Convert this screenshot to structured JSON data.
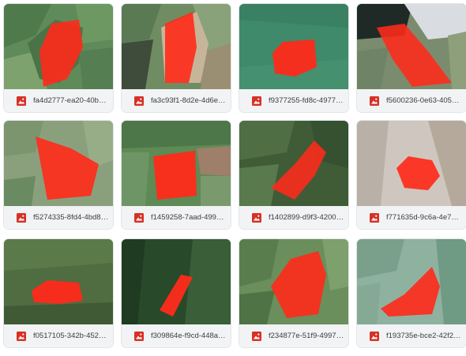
{
  "colors": {
    "card_bg": "#f1f3f4",
    "caption_text": "#3c4043",
    "image_icon": "#d93025",
    "marker": "#ff2a1a"
  },
  "icon_name": "image-file-icon",
  "files": [
    {
      "name": "fa4d2777-ea20-40bd-a..."
    },
    {
      "name": "fa3c93f1-8d2e-4d6e-8..."
    },
    {
      "name": "f9377255-fd8c-4977-9..."
    },
    {
      "name": "f5600236-0e63-4059-a..."
    },
    {
      "name": "f5274335-8fd4-4bd8-a..."
    },
    {
      "name": "f1459258-7aad-4992-8..."
    },
    {
      "name": "f1402899-d9f3-4200-9..."
    },
    {
      "name": "f771635d-9c6a-4e79-9..."
    },
    {
      "name": "f0517105-342b-4525-9..."
    },
    {
      "name": "f309864e-f9cd-448a-a..."
    },
    {
      "name": "f234877e-51f9-4997-a..."
    },
    {
      "name": "f193735e-bce2-42f2-b..."
    }
  ]
}
